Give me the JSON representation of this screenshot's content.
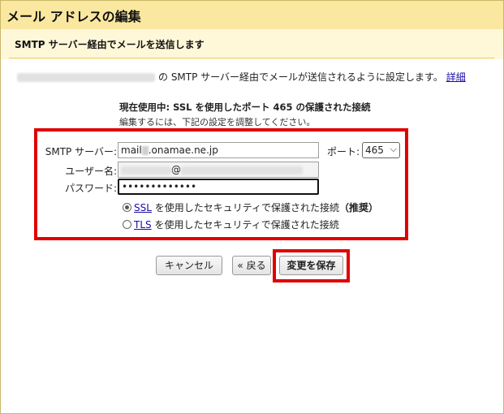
{
  "window": {
    "title": "メール アドレスの編集"
  },
  "subheader": {
    "title": "SMTP サーバー経由でメールを送信します"
  },
  "description": {
    "text": "の SMTP サーバー経由でメールが送信されるように設定します。",
    "link": "詳細"
  },
  "status": {
    "current": "現在使用中: SSL を使用したポート 465 の保護された接続",
    "hint": "編集するには、下記の設定を調整してください。"
  },
  "form": {
    "smtp_label": "SMTP サーバー:",
    "smtp_prefix": "mail",
    "smtp_suffix": ".onamae.ne.jp",
    "port_label": "ポート:",
    "port_value": "465",
    "username_label": "ユーザー名:",
    "username_at": "@",
    "password_label": "パスワード:",
    "password_value": "•••••••••••••",
    "ssl_link": "SSL",
    "ssl_text": " を使用したセキュリティで保護された接続",
    "ssl_recommended": "（推奨）",
    "tls_link": "TLS",
    "tls_text": " を使用したセキュリティで保護された接続"
  },
  "buttons": {
    "cancel": "キャンセル",
    "back": "« 戻る",
    "save": "変更を保存"
  },
  "colors": {
    "title_bg": "#fbe8a0",
    "subheader_bg": "#fff8d8",
    "highlight_red": "#e00000",
    "link": "#1a0dab"
  }
}
